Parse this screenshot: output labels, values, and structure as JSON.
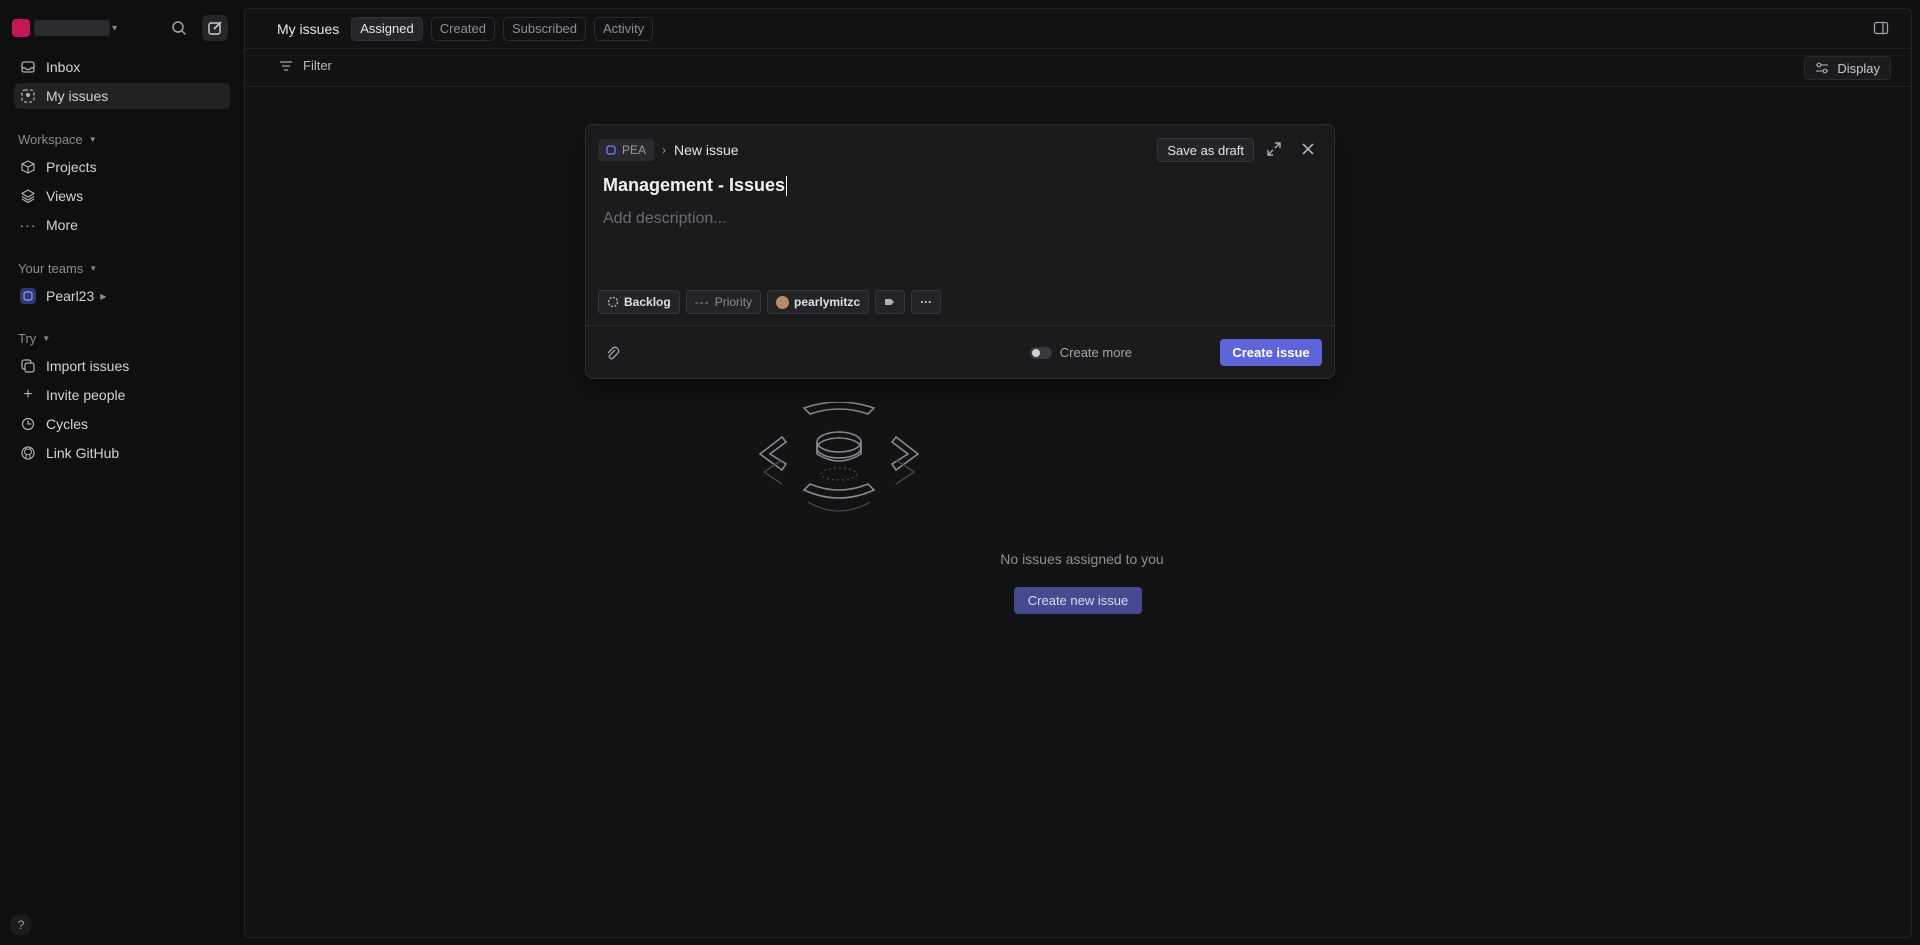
{
  "sidebar": {
    "nav": [
      {
        "label": "Inbox",
        "icon": "inbox-icon"
      },
      {
        "label": "My issues",
        "icon": "my-issues-icon"
      }
    ],
    "workspace": {
      "label": "Workspace",
      "items": [
        {
          "label": "Projects",
          "icon": "cube-icon"
        },
        {
          "label": "Views",
          "icon": "layers-icon"
        },
        {
          "label": "More",
          "icon": "more-icon"
        }
      ]
    },
    "teams": {
      "label": "Your teams",
      "items": [
        {
          "label": "Pearl23",
          "icon": "team-icon"
        }
      ]
    },
    "try": {
      "label": "Try",
      "items": [
        {
          "label": "Import issues",
          "icon": "import-icon"
        },
        {
          "label": "Invite people",
          "icon": "plus-icon"
        },
        {
          "label": "Cycles",
          "icon": "cycles-icon"
        },
        {
          "label": "Link GitHub",
          "icon": "github-icon"
        }
      ]
    },
    "help": "?"
  },
  "header": {
    "title": "My issues",
    "tabs": [
      "Assigned",
      "Created",
      "Subscribed",
      "Activity"
    ],
    "active_tab": "Assigned"
  },
  "toolbar": {
    "filter_label": "Filter",
    "display_label": "Display"
  },
  "empty_state": {
    "message": "No issues assigned to you",
    "button_label": "Create new issue"
  },
  "modal": {
    "team_key": "PEA",
    "breadcrumb_current": "New issue",
    "save_draft_label": "Save as draft",
    "title_value": "Management - Issues",
    "description_placeholder": "Add description...",
    "props": {
      "status": "Backlog",
      "priority": "Priority",
      "assignee": "pearlymitzc"
    },
    "create_more_label": "Create more",
    "create_more_on": false,
    "create_button_label": "Create issue"
  },
  "colors": {
    "accent": "#5e65d8",
    "background": "#0f0f10",
    "panel": "#131315"
  }
}
